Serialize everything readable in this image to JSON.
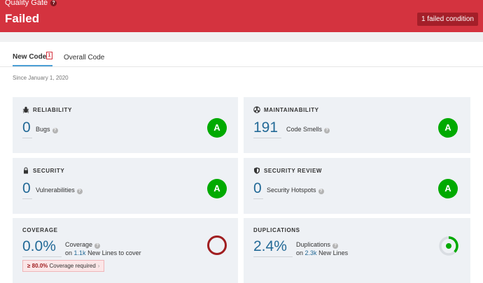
{
  "quality_gate": {
    "label": "Quality Gate",
    "help": "?",
    "status": "Failed",
    "conditions_badge": "1 failed condition",
    "color": "#d4333f"
  },
  "tabs": [
    {
      "label": "New Code",
      "badge": "1",
      "active": true
    },
    {
      "label": "Overall Code",
      "active": false
    }
  ],
  "since": "Since January 1, 2020",
  "cards": {
    "reliability": {
      "title": "RELIABILITY",
      "icon": "bug-icon",
      "value": "0",
      "label": "Bugs",
      "grade": "A"
    },
    "maintainability": {
      "title": "MAINTAINABILITY",
      "icon": "radiation-icon",
      "value": "191",
      "label": "Code Smells",
      "grade": "A"
    },
    "security": {
      "title": "SECURITY",
      "icon": "lock-icon",
      "value": "0",
      "label": "Vulnerabilities",
      "grade": "A"
    },
    "security_review": {
      "title": "SECURITY REVIEW",
      "icon": "shield-icon",
      "value": "0",
      "label": "Security Hotspots",
      "grade": "A"
    },
    "coverage": {
      "title": "COVERAGE",
      "value": "0.0%",
      "label": "Coverage",
      "lines_prefix": "on",
      "lines_value": "1.1k",
      "lines_suffix": "New Lines to cover",
      "requirement_value": "≥ 80.0%",
      "requirement_label": "Coverage required"
    },
    "duplications": {
      "title": "DUPLICATIONS",
      "value": "2.4%",
      "label": "Duplications",
      "lines_prefix": "on",
      "lines_value": "2.3k",
      "lines_suffix": "New Lines"
    }
  },
  "colors": {
    "grade_a": "#00aa00",
    "link": "#236a97",
    "failed_ring": "#a01e20"
  }
}
